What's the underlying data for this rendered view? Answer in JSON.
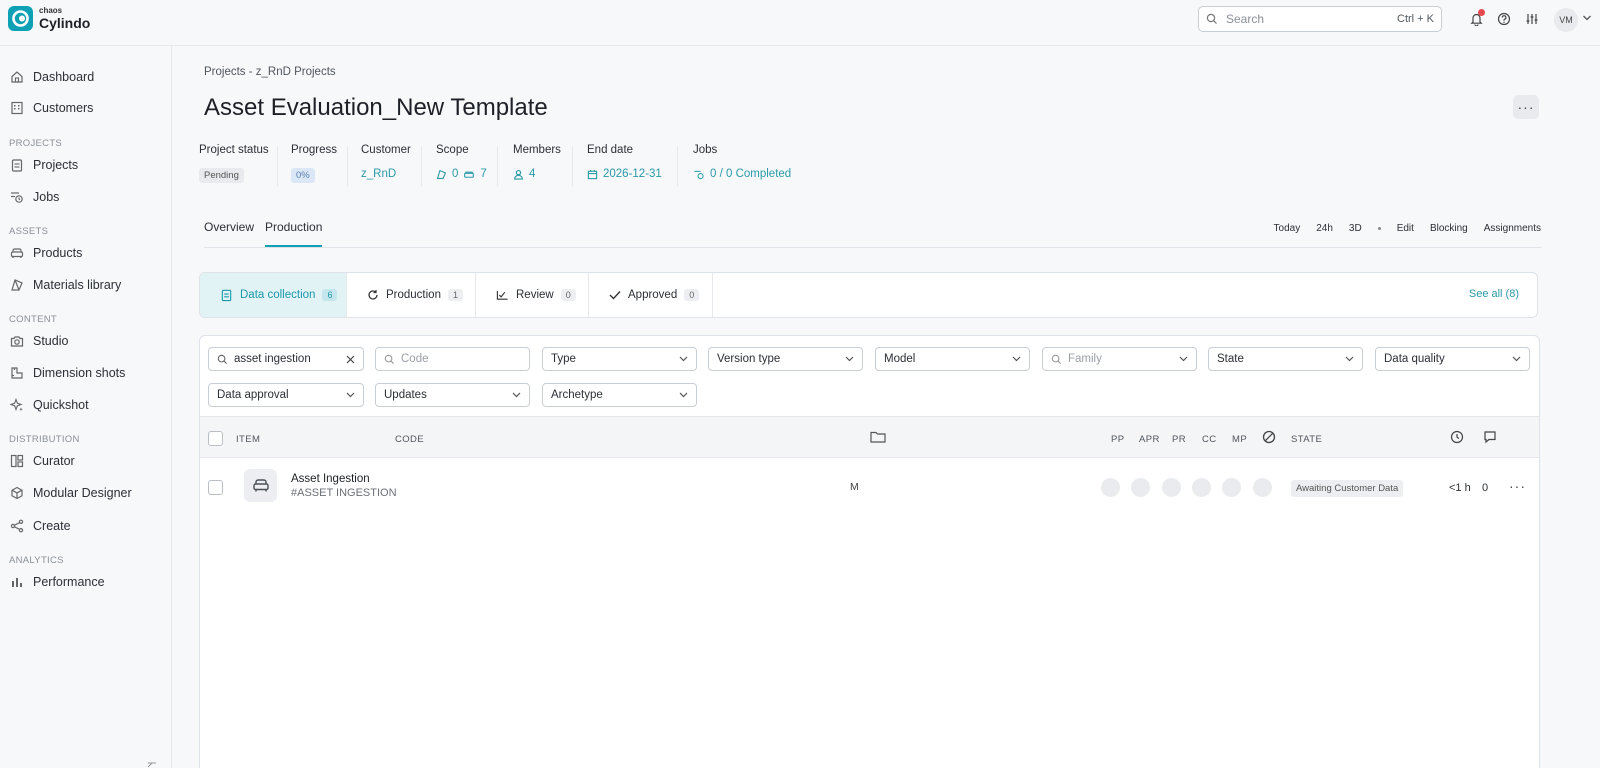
{
  "brand": {
    "small": "chaos",
    "name": "Cylindo"
  },
  "search": {
    "placeholder": "Search",
    "shortcut": "Ctrl + K"
  },
  "user": {
    "initials": "VM"
  },
  "sidebar": {
    "items": [
      {
        "label": "Dashboard"
      },
      {
        "label": "Customers"
      },
      {
        "label": "Projects"
      },
      {
        "label": "Jobs"
      },
      {
        "label": "Products"
      },
      {
        "label": "Materials library"
      },
      {
        "label": "Studio"
      },
      {
        "label": "Dimension shots"
      },
      {
        "label": "Quickshot"
      },
      {
        "label": "Curator"
      },
      {
        "label": "Modular Designer"
      },
      {
        "label": "Create"
      },
      {
        "label": "Performance"
      }
    ],
    "sections": [
      "PROJECTS",
      "ASSETS",
      "CONTENT",
      "DISTRIBUTION",
      "ANALYTICS"
    ]
  },
  "page": {
    "breadcrumb": "Projects - z_RnD Projects",
    "title": "Asset Evaluation_New Template",
    "more": "···"
  },
  "meta": {
    "status_label": "Project status",
    "status_value": "Pending",
    "progress_label": "Progress",
    "progress_value": "0%",
    "customer_label": "Customer",
    "customer_value": "z_RnD",
    "scope_label": "Scope",
    "scope_a": "0",
    "scope_b": "7",
    "members_label": "Members",
    "members_value": "4",
    "end_label": "End date",
    "end_value": "2026-12-31",
    "jobs_label": "Jobs",
    "jobs_value": "0 / 0 Completed"
  },
  "tabs": {
    "overview": "Overview",
    "production": "Production"
  },
  "tools": {
    "today": "Today",
    "h24": "24h",
    "d3": "3D",
    "edit": "Edit",
    "blocking": "Blocking",
    "assignments": "Assignments"
  },
  "stages": {
    "data_collection": {
      "label": "Data collection",
      "count": "6"
    },
    "production": {
      "label": "Production",
      "count": "1"
    },
    "review": {
      "label": "Review",
      "count": "0"
    },
    "approved": {
      "label": "Approved",
      "count": "0"
    },
    "see_all": "See all (8)"
  },
  "filters": {
    "search_value": "asset ingestion",
    "code_placeholder": "Code",
    "type": "Type",
    "version_type": "Version type",
    "model": "Model",
    "family_placeholder": "Family",
    "state": "State",
    "data_quality": "Data quality",
    "data_approval": "Data approval",
    "updates": "Updates",
    "archetype": "Archetype"
  },
  "table": {
    "headers": {
      "item": "ITEM",
      "code": "CODE",
      "pp": "PP",
      "apr": "APR",
      "pr": "PR",
      "cc": "CC",
      "mp": "MP",
      "state": "STATE"
    },
    "rows": [
      {
        "name": "Asset Ingestion",
        "code": "#ASSET INGESTION",
        "folder": "M",
        "state": "Awaiting Customer Data",
        "time": "<1 h",
        "comments": "0",
        "more": "···"
      }
    ]
  }
}
